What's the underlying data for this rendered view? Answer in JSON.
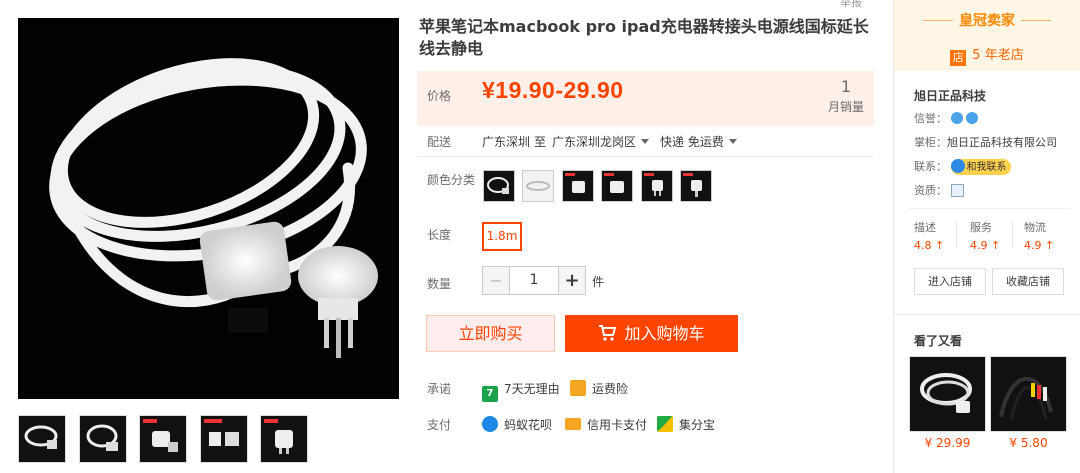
{
  "page": {
    "report_label": "举报"
  },
  "product": {
    "title": "苹果笔记本macbook pro ipad充电器转接头电源线国标延长线去静电",
    "price_label": "价格",
    "price": "¥19.90-29.90",
    "sales_count": "1",
    "sales_label": "月销量"
  },
  "shipping": {
    "label": "配送",
    "from": "广东深圳",
    "to_word": "至",
    "to": "广东深圳龙岗区",
    "method": "快递 免运费"
  },
  "color": {
    "label": "颜色分类",
    "options_count": 6
  },
  "length": {
    "label": "长度",
    "options": [
      "1.8m"
    ]
  },
  "quantity": {
    "label": "数量",
    "minus": "−",
    "value": "1",
    "plus": "+",
    "unit": "件"
  },
  "actions": {
    "buy_now": "立即购买",
    "add_to_cart": "加入购物车"
  },
  "promise": {
    "label": "承诺",
    "items": [
      {
        "icon": "seven-day-return-icon",
        "icon_text": "7",
        "text": "7天无理由",
        "color": "#1aa34a"
      },
      {
        "icon": "shipping-insurance-icon",
        "icon_text": "",
        "text": "运费险",
        "color": "#f5a623"
      }
    ]
  },
  "payment": {
    "label": "支付",
    "items": [
      {
        "icon": "huabei-icon",
        "text": "蚂蚁花呗",
        "color": "#1e88e5"
      },
      {
        "icon": "credit-card-icon",
        "text": "信用卡支付",
        "color": "#f5a623"
      },
      {
        "icon": "jifenbao-icon",
        "text": "集分宝",
        "color": "#22aa44"
      }
    ]
  },
  "store": {
    "badge_title": "皇冠卖家",
    "age_icon_text": "店",
    "age": "5 年老店",
    "name": "旭日正品科技",
    "credit_label": "信誉：",
    "owner_label": "掌柜：",
    "owner": "旭日正品科技有限公司",
    "contact_label": "联系：",
    "contact_button": "和我联系",
    "qualification_label": "资质：",
    "ratings": [
      {
        "label": "描述",
        "score": "4.8 ↑"
      },
      {
        "label": "服务",
        "score": "4.9 ↑"
      },
      {
        "label": "物流",
        "score": "4.9 ↑"
      }
    ],
    "enter_shop": "进入店铺",
    "favorite_shop": "收藏店铺"
  },
  "related": {
    "title": "看了又看",
    "items": [
      {
        "price": "¥ 29.99"
      },
      {
        "price": "¥ 5.80"
      }
    ]
  },
  "colors": {
    "accent": "#ff4400",
    "price_bg": "#fef0e9",
    "crown_bg": "#fff6e5"
  }
}
